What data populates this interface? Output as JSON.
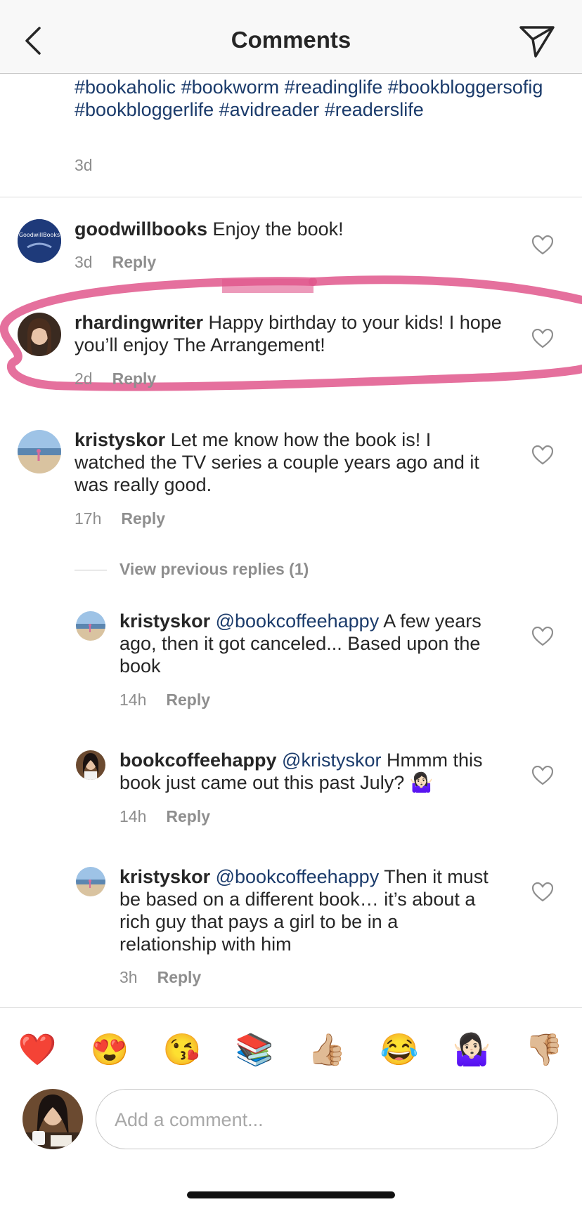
{
  "header": {
    "title": "Comments"
  },
  "caption": {
    "tags": "#bookaholic #bookworm #readinglife #bookbloggersofig #bookbloggerlife #avidreader #readerslife",
    "time": "3d"
  },
  "comments": [
    {
      "username": "goodwillbooks",
      "text": " Enjoy the book!",
      "time": "3d",
      "reply": "Reply",
      "avatar_text": "GoodwillBooks"
    },
    {
      "username": "rhardingwriter",
      "text": " Happy birthday to your kids! I hope you’ll enjoy The Arrangement!",
      "time": "2d",
      "reply": "Reply"
    },
    {
      "username": "kristyskor",
      "text": " Let me know how the book is! I watched the TV series a couple years ago and it was really good.",
      "time": "17h",
      "reply": "Reply"
    }
  ],
  "view_previous": "View previous replies (1)",
  "replies": [
    {
      "username": "kristyskor",
      "mention": "@bookcoffeehappy",
      "text": " A few years ago, then it got canceled... Based upon the book",
      "time": "14h",
      "reply": "Reply"
    },
    {
      "username": "bookcoffeehappy",
      "mention": "@kristyskor",
      "text": " Hmmm this book just came out this past July? 🤷🏻‍♀️",
      "time": "14h",
      "reply": "Reply"
    },
    {
      "username": "kristyskor",
      "mention": "@bookcoffeehappy",
      "text": " Then it must be based on a different book… it’s about a rich guy that pays a girl to be in a relationship with him",
      "time": "3h",
      "reply": "Reply"
    }
  ],
  "emoji_bar": [
    "❤️",
    "😍",
    "😘",
    "📚",
    "👍🏼",
    "😂",
    "🤷🏻‍♀️",
    "👎🏼"
  ],
  "input": {
    "placeholder": "Add a comment..."
  },
  "colors": {
    "mention": "#1b3b6b",
    "meta": "#8e8e8e",
    "highlight": "#e0578c"
  }
}
